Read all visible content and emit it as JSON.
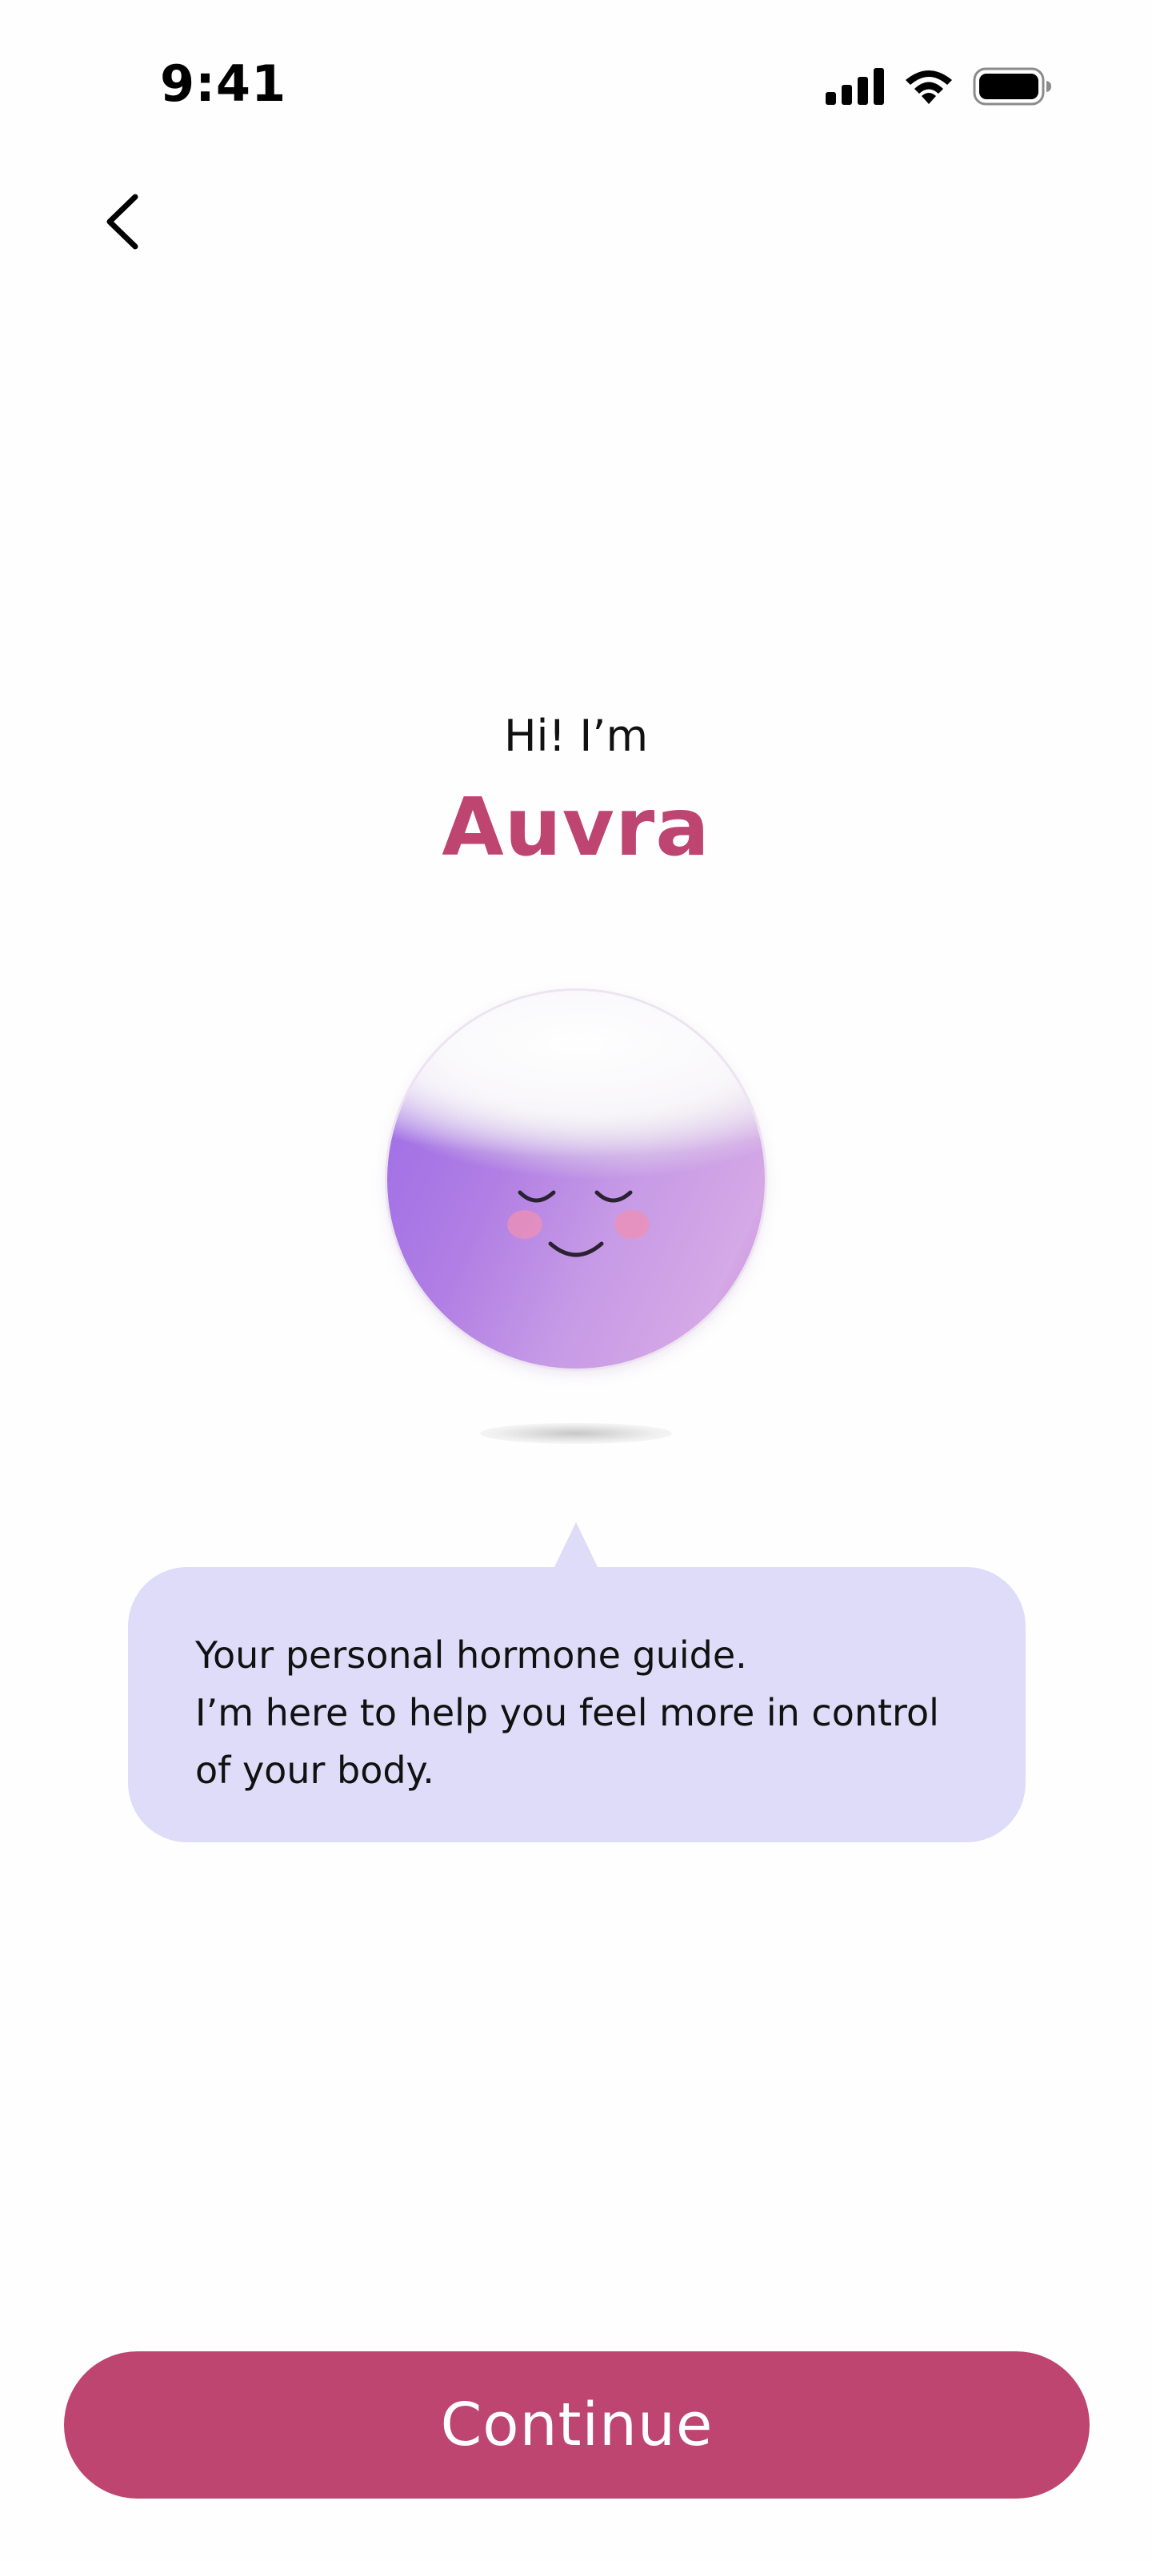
{
  "status_bar": {
    "time": "9:41",
    "icons": [
      "cellular-signal-icon",
      "wifi-icon",
      "battery-icon"
    ]
  },
  "navigation": {
    "back_icon": "chevron-left-icon"
  },
  "intro": {
    "greeting": "Hi! I’m",
    "name": "Auvra"
  },
  "avatar": {
    "icon": "smiling-orb-avatar",
    "expression": "content, eyes closed, blushing"
  },
  "speech_bubble": {
    "lines": [
      "Your personal hormone guide.",
      "I’m here to help you feel more in control",
      "of your body."
    ]
  },
  "footer": {
    "continue_label": "Continue"
  },
  "colors": {
    "brand": "#bd456f",
    "bubble": "#dedcf8",
    "background": "#fefefe",
    "orb_purple": "#9b6ae6",
    "orb_pink": "#d5a8e6",
    "blush": "#ef8fb4"
  }
}
